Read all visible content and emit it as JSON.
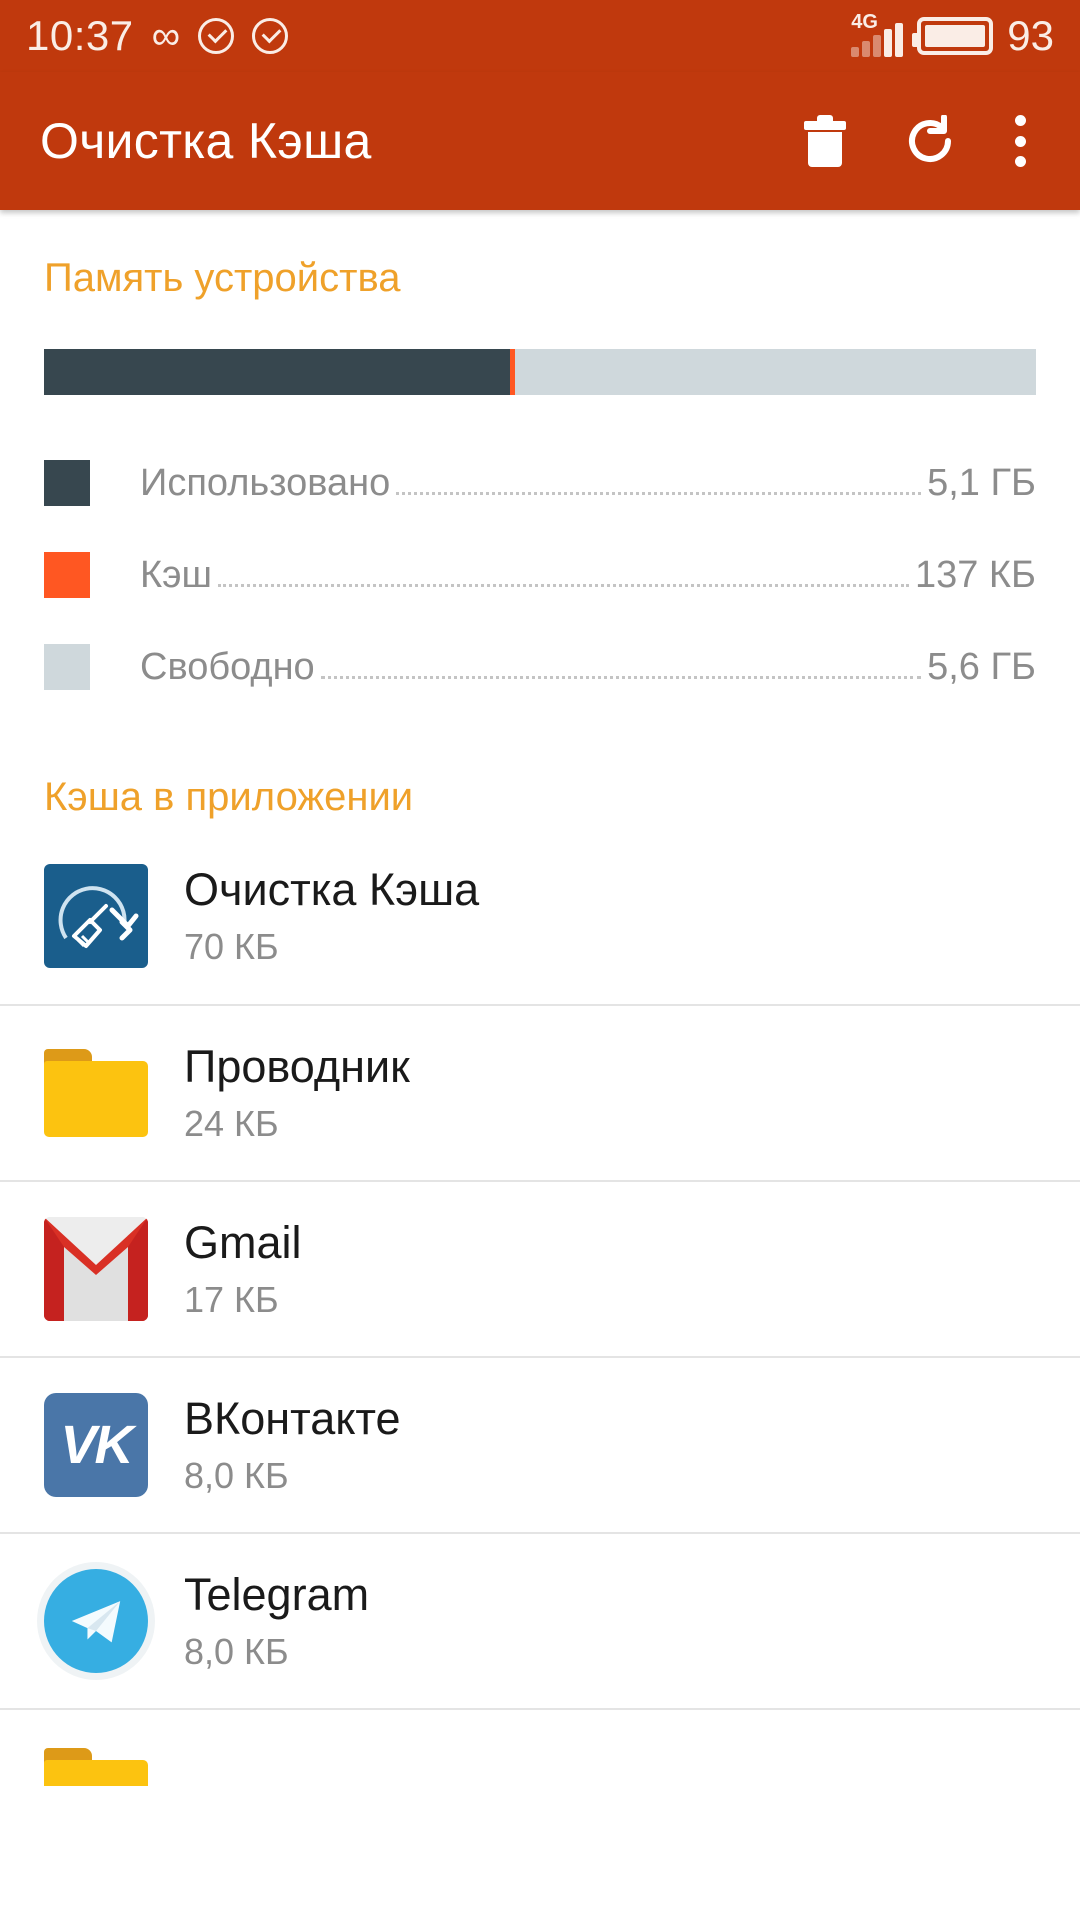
{
  "statusbar": {
    "clock": "10:37",
    "infinity_icon": "infinity-icon",
    "check_icon_1": "check-circle-icon",
    "check_icon_2": "check-circle-icon",
    "network_type": "4G",
    "battery_percent": "93"
  },
  "toolbar": {
    "title": "Очистка Кэша",
    "delete_label": "trash-icon",
    "refresh_label": "refresh-icon",
    "more_label": "overflow-menu-icon"
  },
  "memory": {
    "section_title": "Память устройства",
    "bar": {
      "used_percent": 47,
      "cache_percent": 0.5,
      "free_percent": 52.5
    },
    "legend": [
      {
        "label": "Использовано",
        "value": "5,1 ГБ",
        "color": "#37474F"
      },
      {
        "label": "Кэш",
        "value": "137 КБ",
        "color": "#FF5722"
      },
      {
        "label": "Свободно",
        "value": "5,6 ГБ",
        "color": "#CFD8DC"
      }
    ]
  },
  "apps": {
    "section_title": "Кэша в приложении",
    "items": [
      {
        "name": "Очистка Кэша",
        "size": "70 КБ",
        "icon": "cache-cleaner-icon"
      },
      {
        "name": "Проводник",
        "size": "24 КБ",
        "icon": "folder-icon"
      },
      {
        "name": "Gmail",
        "size": "17 КБ",
        "icon": "gmail-icon"
      },
      {
        "name": "ВКонтакте",
        "size": "8,0 КБ",
        "icon": "vk-icon"
      },
      {
        "name": "Telegram",
        "size": "8,0 КБ",
        "icon": "telegram-icon"
      }
    ]
  },
  "colors": {
    "toolbar": "#C0390D",
    "accent": "#EFA12A",
    "used": "#37474F",
    "cache": "#FF5722",
    "free": "#CFD8DC"
  }
}
